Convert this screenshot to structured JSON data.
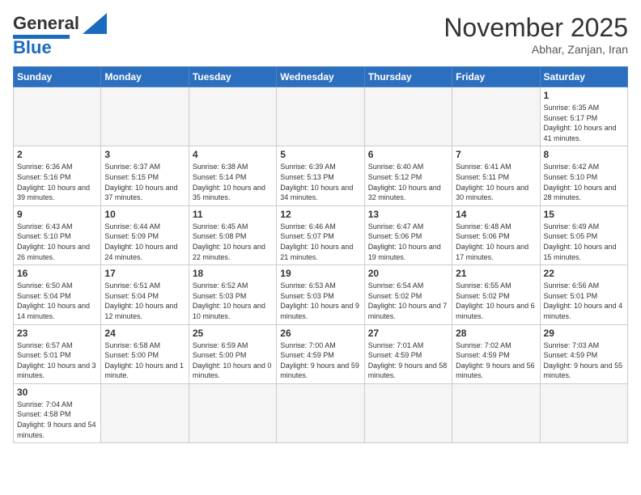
{
  "header": {
    "logo_general": "General",
    "logo_blue": "Blue",
    "month_year": "November 2025",
    "location": "Abhar, Zanjan, Iran"
  },
  "weekdays": [
    "Sunday",
    "Monday",
    "Tuesday",
    "Wednesday",
    "Thursday",
    "Friday",
    "Saturday"
  ],
  "days": [
    {
      "num": "",
      "info": ""
    },
    {
      "num": "",
      "info": ""
    },
    {
      "num": "",
      "info": ""
    },
    {
      "num": "",
      "info": ""
    },
    {
      "num": "",
      "info": ""
    },
    {
      "num": "",
      "info": ""
    },
    {
      "num": "1",
      "info": "Sunrise: 6:35 AM\nSunset: 5:17 PM\nDaylight: 10 hours and 41 minutes."
    },
    {
      "num": "2",
      "info": "Sunrise: 6:36 AM\nSunset: 5:16 PM\nDaylight: 10 hours and 39 minutes."
    },
    {
      "num": "3",
      "info": "Sunrise: 6:37 AM\nSunset: 5:15 PM\nDaylight: 10 hours and 37 minutes."
    },
    {
      "num": "4",
      "info": "Sunrise: 6:38 AM\nSunset: 5:14 PM\nDaylight: 10 hours and 35 minutes."
    },
    {
      "num": "5",
      "info": "Sunrise: 6:39 AM\nSunset: 5:13 PM\nDaylight: 10 hours and 34 minutes."
    },
    {
      "num": "6",
      "info": "Sunrise: 6:40 AM\nSunset: 5:12 PM\nDaylight: 10 hours and 32 minutes."
    },
    {
      "num": "7",
      "info": "Sunrise: 6:41 AM\nSunset: 5:11 PM\nDaylight: 10 hours and 30 minutes."
    },
    {
      "num": "8",
      "info": "Sunrise: 6:42 AM\nSunset: 5:10 PM\nDaylight: 10 hours and 28 minutes."
    },
    {
      "num": "9",
      "info": "Sunrise: 6:43 AM\nSunset: 5:10 PM\nDaylight: 10 hours and 26 minutes."
    },
    {
      "num": "10",
      "info": "Sunrise: 6:44 AM\nSunset: 5:09 PM\nDaylight: 10 hours and 24 minutes."
    },
    {
      "num": "11",
      "info": "Sunrise: 6:45 AM\nSunset: 5:08 PM\nDaylight: 10 hours and 22 minutes."
    },
    {
      "num": "12",
      "info": "Sunrise: 6:46 AM\nSunset: 5:07 PM\nDaylight: 10 hours and 21 minutes."
    },
    {
      "num": "13",
      "info": "Sunrise: 6:47 AM\nSunset: 5:06 PM\nDaylight: 10 hours and 19 minutes."
    },
    {
      "num": "14",
      "info": "Sunrise: 6:48 AM\nSunset: 5:06 PM\nDaylight: 10 hours and 17 minutes."
    },
    {
      "num": "15",
      "info": "Sunrise: 6:49 AM\nSunset: 5:05 PM\nDaylight: 10 hours and 15 minutes."
    },
    {
      "num": "16",
      "info": "Sunrise: 6:50 AM\nSunset: 5:04 PM\nDaylight: 10 hours and 14 minutes."
    },
    {
      "num": "17",
      "info": "Sunrise: 6:51 AM\nSunset: 5:04 PM\nDaylight: 10 hours and 12 minutes."
    },
    {
      "num": "18",
      "info": "Sunrise: 6:52 AM\nSunset: 5:03 PM\nDaylight: 10 hours and 10 minutes."
    },
    {
      "num": "19",
      "info": "Sunrise: 6:53 AM\nSunset: 5:03 PM\nDaylight: 10 hours and 9 minutes."
    },
    {
      "num": "20",
      "info": "Sunrise: 6:54 AM\nSunset: 5:02 PM\nDaylight: 10 hours and 7 minutes."
    },
    {
      "num": "21",
      "info": "Sunrise: 6:55 AM\nSunset: 5:02 PM\nDaylight: 10 hours and 6 minutes."
    },
    {
      "num": "22",
      "info": "Sunrise: 6:56 AM\nSunset: 5:01 PM\nDaylight: 10 hours and 4 minutes."
    },
    {
      "num": "23",
      "info": "Sunrise: 6:57 AM\nSunset: 5:01 PM\nDaylight: 10 hours and 3 minutes."
    },
    {
      "num": "24",
      "info": "Sunrise: 6:58 AM\nSunset: 5:00 PM\nDaylight: 10 hours and 1 minute."
    },
    {
      "num": "25",
      "info": "Sunrise: 6:59 AM\nSunset: 5:00 PM\nDaylight: 10 hours and 0 minutes."
    },
    {
      "num": "26",
      "info": "Sunrise: 7:00 AM\nSunset: 4:59 PM\nDaylight: 9 hours and 59 minutes."
    },
    {
      "num": "27",
      "info": "Sunrise: 7:01 AM\nSunset: 4:59 PM\nDaylight: 9 hours and 58 minutes."
    },
    {
      "num": "28",
      "info": "Sunrise: 7:02 AM\nSunset: 4:59 PM\nDaylight: 9 hours and 56 minutes."
    },
    {
      "num": "29",
      "info": "Sunrise: 7:03 AM\nSunset: 4:59 PM\nDaylight: 9 hours and 55 minutes."
    },
    {
      "num": "30",
      "info": "Sunrise: 7:04 AM\nSunset: 4:58 PM\nDaylight: 9 hours and 54 minutes."
    },
    {
      "num": "",
      "info": ""
    },
    {
      "num": "",
      "info": ""
    },
    {
      "num": "",
      "info": ""
    },
    {
      "num": "",
      "info": ""
    },
    {
      "num": "",
      "info": ""
    },
    {
      "num": "",
      "info": ""
    }
  ]
}
